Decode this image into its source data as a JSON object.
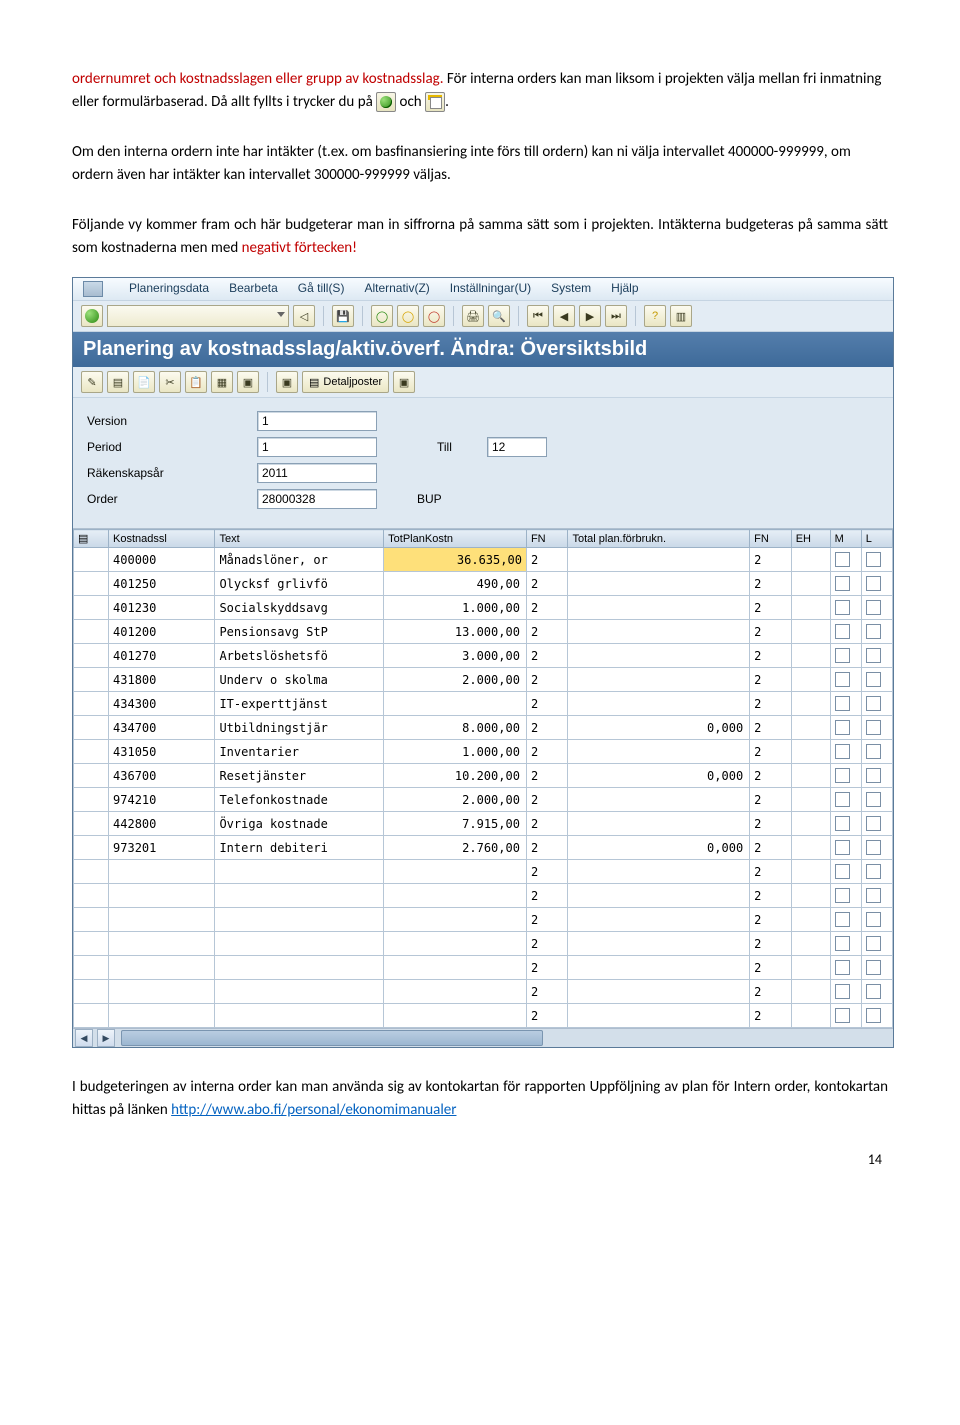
{
  "doc": {
    "p1_a": "ordernumret och kostnadsslagen eller grupp av kostnadsslag.",
    "p1_b": " För interna orders kan man liksom i projekten välja mellan fri inmatning eller formulärbaserad. Då allt fyllts i trycker du på ",
    "p1_c": " och ",
    "p1_d": ".",
    "p2_a": "Om den interna ordern inte har intäkter (t.ex. om basfinansiering inte förs till ordern) kan ni välja intervallet 400000-999999, om ordern även har intäkter kan intervallet 300000-999999 väljas.",
    "p3_a": "Följande vy kommer fram och här budgeterar man in siffrorna på samma sätt som i projekten. Intäkterna budgeteras på samma sätt som kostnaderna men med ",
    "p3_red": "negativt förtecken!",
    "p4_a": "I budgeteringen av interna order kan man använda sig av kontokartan för rapporten Uppföljning av plan för Intern order, kontokartan hittas på länken ",
    "p4_link": "http://www.abo.fi/personal/ekonomimanualer"
  },
  "sap": {
    "menu": [
      "Planeringsdata",
      "Bearbeta",
      "Gå till(S)",
      "Alternativ(Z)",
      "Inställningar(U)",
      "System",
      "Hjälp"
    ],
    "title": "Planering av kostnadsslag/aktiv.överf. Ändra: Översiktsbild",
    "detail_btn": "Detaljposter",
    "fields": {
      "version_label": "Version",
      "version_val": "1",
      "period_label": "Period",
      "period_val": "1",
      "till_label": "Till",
      "till_val": "12",
      "year_label": "Räkenskapsår",
      "year_val": "2011",
      "order_label": "Order",
      "order_val": "28000328",
      "order_after": "BUP"
    },
    "cols": [
      "Kostnadssl",
      "Text",
      "TotPlanKostn",
      "FN",
      "Total plan.förbrukn.",
      "FN",
      "EH",
      "M",
      "L"
    ],
    "rows": [
      {
        "k": "400000",
        "t": "Månadslöner, or",
        "p": "36.635,00",
        "fn": "2",
        "f": "",
        "fn2": "2"
      },
      {
        "k": "401250",
        "t": "Olycksf grlivfö",
        "p": "490,00",
        "fn": "2",
        "f": "",
        "fn2": "2"
      },
      {
        "k": "401230",
        "t": "Socialskyddsavg",
        "p": "1.000,00",
        "fn": "2",
        "f": "",
        "fn2": "2"
      },
      {
        "k": "401200",
        "t": "Pensionsavg StP",
        "p": "13.000,00",
        "fn": "2",
        "f": "",
        "fn2": "2"
      },
      {
        "k": "401270",
        "t": "Arbetslöshetsfö",
        "p": "3.000,00",
        "fn": "2",
        "f": "",
        "fn2": "2"
      },
      {
        "k": "431800",
        "t": "Underv o skolma",
        "p": "2.000,00",
        "fn": "2",
        "f": "",
        "fn2": "2"
      },
      {
        "k": "434300",
        "t": "IT-experttjänst",
        "p": "",
        "fn": "2",
        "f": "",
        "fn2": "2"
      },
      {
        "k": "434700",
        "t": "Utbildningstjär",
        "p": "8.000,00",
        "fn": "2",
        "f": "0,000",
        "fn2": "2"
      },
      {
        "k": "431050",
        "t": "Inventarier",
        "p": "1.000,00",
        "fn": "2",
        "f": "",
        "fn2": "2"
      },
      {
        "k": "436700",
        "t": "Resetjänster",
        "p": "10.200,00",
        "fn": "2",
        "f": "0,000",
        "fn2": "2"
      },
      {
        "k": "974210",
        "t": "Telefonkostnade",
        "p": "2.000,00",
        "fn": "2",
        "f": "",
        "fn2": "2"
      },
      {
        "k": "442800",
        "t": "Övriga kostnade",
        "p": "7.915,00",
        "fn": "2",
        "f": "",
        "fn2": "2"
      },
      {
        "k": "973201",
        "t": "Intern debiteri",
        "p": "2.760,00",
        "fn": "2",
        "f": "0,000",
        "fn2": "2"
      },
      {
        "k": "",
        "t": "",
        "p": "",
        "fn": "2",
        "f": "",
        "fn2": "2"
      },
      {
        "k": "",
        "t": "",
        "p": "",
        "fn": "2",
        "f": "",
        "fn2": "2"
      },
      {
        "k": "",
        "t": "",
        "p": "",
        "fn": "2",
        "f": "",
        "fn2": "2"
      },
      {
        "k": "",
        "t": "",
        "p": "",
        "fn": "2",
        "f": "",
        "fn2": "2"
      },
      {
        "k": "",
        "t": "",
        "p": "",
        "fn": "2",
        "f": "",
        "fn2": "2"
      },
      {
        "k": "",
        "t": "",
        "p": "",
        "fn": "2",
        "f": "",
        "fn2": "2"
      },
      {
        "k": "",
        "t": "",
        "p": "",
        "fn": "2",
        "f": "",
        "fn2": "2"
      }
    ]
  },
  "page_number": "14"
}
